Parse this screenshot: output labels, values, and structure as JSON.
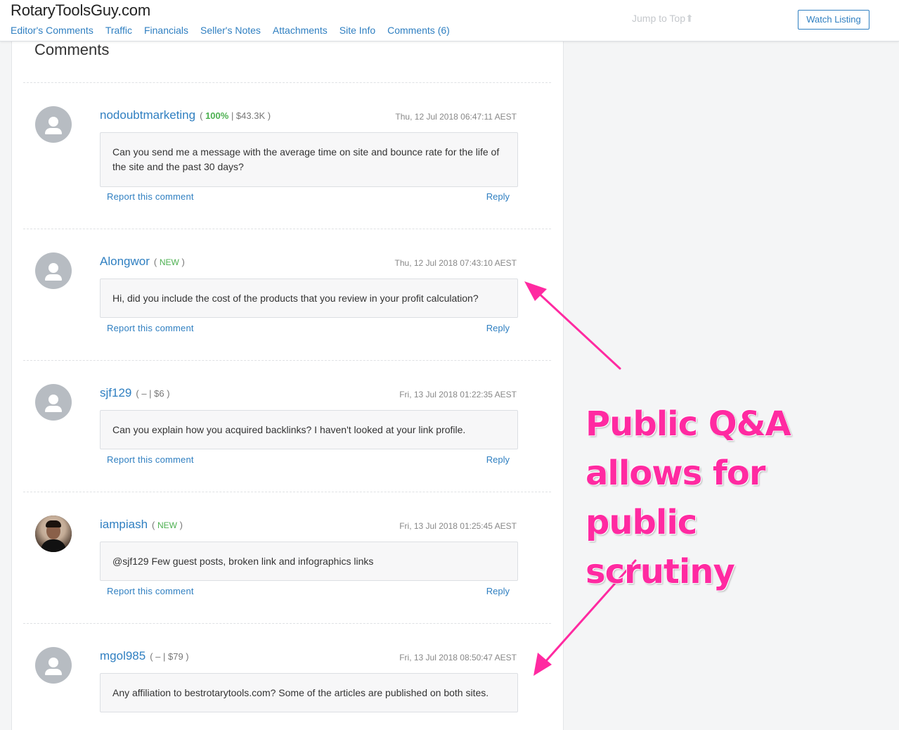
{
  "header": {
    "site_title": "RotaryToolsGuy.com",
    "nav": [
      "Editor's Comments",
      "Traffic",
      "Financials",
      "Seller's Notes",
      "Attachments",
      "Site Info",
      "Comments (6)"
    ],
    "jump_to_top": "Jump to Top",
    "watch_listing": "Watch Listing"
  },
  "panel": {
    "title": "Comments"
  },
  "comments": [
    {
      "username": "nodoubtmarketing",
      "meta_open": "(",
      "meta_pct": "100%",
      "meta_rest": "| $43.3K )",
      "timestamp": "Thu, 12 Jul 2018 06:47:11 AEST",
      "text": "Can you send me a message with the average time on site and bounce rate for the life of the site and the past 30 days?",
      "report": "Report this comment",
      "reply": "Reply"
    },
    {
      "username": "Alongwor",
      "meta_open": "(",
      "meta_new": "NEW",
      "meta_close": ")",
      "timestamp": "Thu, 12 Jul 2018 07:43:10 AEST",
      "text": "Hi, did you include the cost of the products that you review in your profit calculation?",
      "report": "Report this comment",
      "reply": "Reply"
    },
    {
      "username": "sjf129",
      "meta_text": "( – | $6 )",
      "timestamp": "Fri, 13 Jul 2018 01:22:35 AEST",
      "text": "Can you explain how you acquired backlinks? I haven't looked at your link profile.",
      "report": "Report this comment",
      "reply": "Reply"
    },
    {
      "username": "iampiash",
      "meta_open": "(",
      "meta_new": "NEW",
      "meta_close": ")",
      "timestamp": "Fri, 13 Jul 2018 01:25:45 AEST",
      "text": "@sjf129 Few guest posts, broken link and infographics links",
      "report": "Report this comment",
      "reply": "Reply"
    },
    {
      "username": "mgol985",
      "meta_text": "( – | $79 )",
      "timestamp": "Fri, 13 Jul 2018 08:50:47 AEST",
      "text": "Any affiliation to bestrotarytools.com? Some of the articles are published on both sites."
    }
  ],
  "annotation": {
    "lines": [
      "Public Q&A",
      "allows for public",
      "scrutiny"
    ],
    "color": "#ff2aa1"
  },
  "icons": [
    "user-avatar-icon",
    "arrow-up-icon"
  ]
}
